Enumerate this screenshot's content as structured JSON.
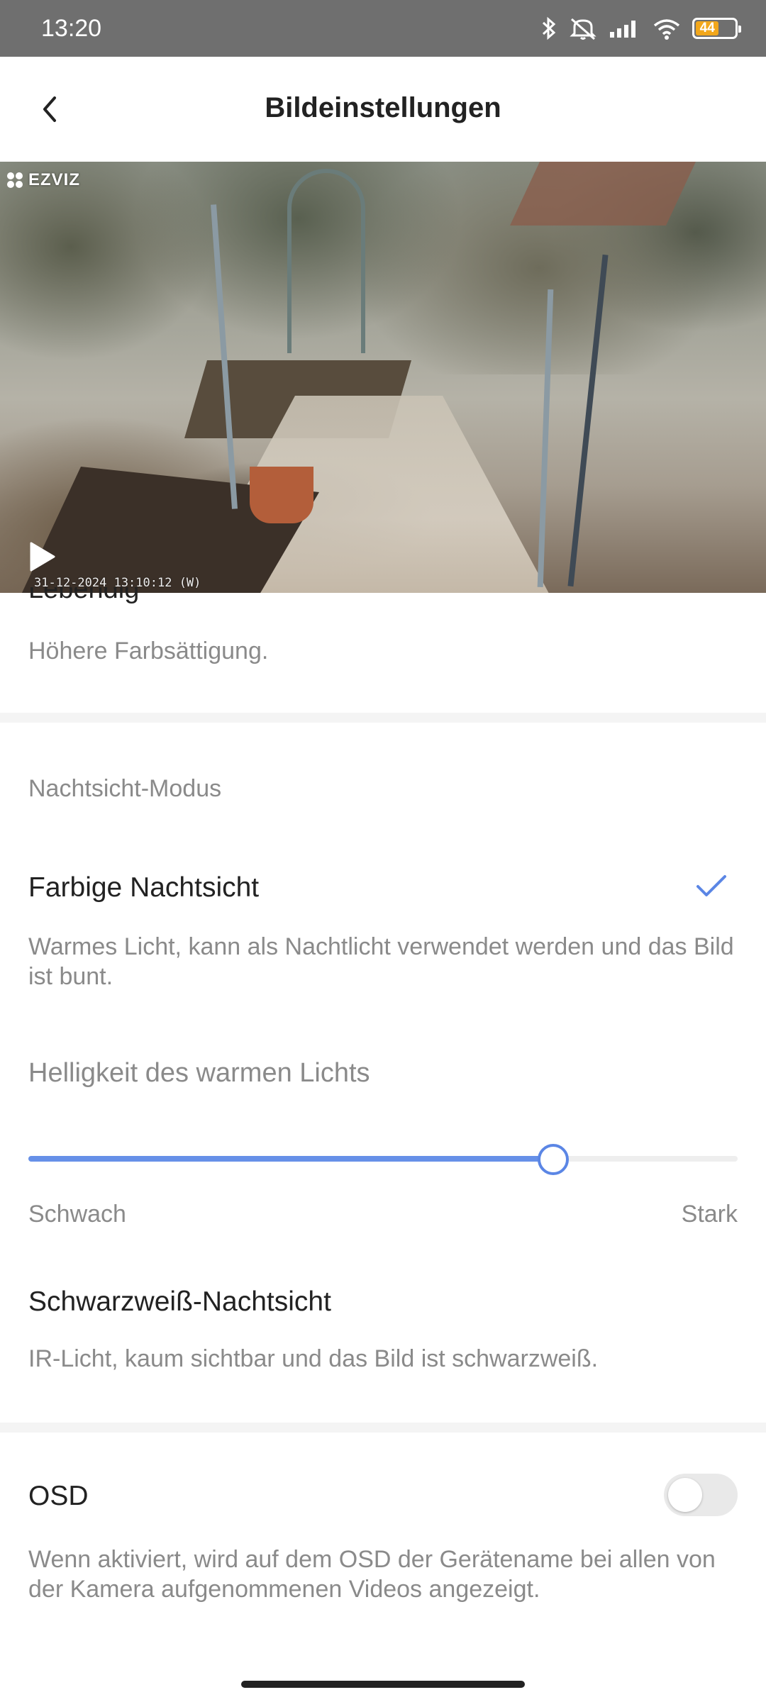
{
  "status_bar": {
    "time": "13:20",
    "battery_level": "44",
    "icons": [
      "bluetooth-icon",
      "mute-icon",
      "signal-icon",
      "wifi-icon",
      "battery-icon"
    ]
  },
  "header": {
    "title": "Bildeinstellungen",
    "back_icon": "chevron-left-icon"
  },
  "video": {
    "brand": "EZVIZ",
    "timestamp": "31-12-2024 13:10:12 (W)",
    "play_icon": "play-icon"
  },
  "image_style": {
    "option_title": "Lebendig",
    "option_description": "Höhere Farbsättigung."
  },
  "night_vision": {
    "section_label": "Nachtsicht-Modus",
    "color_option": {
      "title": "Farbige Nachtsicht",
      "description": "Warmes Licht, kann als Nachtlicht verwendet werden und das Bild ist bunt.",
      "selected": true
    },
    "brightness": {
      "label": "Helligkeit des warmen Lichts",
      "value_fraction": 0.74,
      "min_label": "Schwach",
      "max_label": "Stark"
    },
    "bw_option": {
      "title": "Schwarzweiß-Nachtsicht",
      "description": "IR-Licht, kaum sichtbar und das Bild ist schwarzweiß.",
      "selected": false
    }
  },
  "osd": {
    "title": "OSD",
    "enabled": false,
    "description": "Wenn aktiviert, wird auf dem OSD der Gerätename bei allen von der Kamera aufgenommenen Videos angezeigt."
  },
  "colors": {
    "accent": "#5b86e5",
    "status_bar": "#6f6f6f",
    "battery": "#f2a71b"
  }
}
